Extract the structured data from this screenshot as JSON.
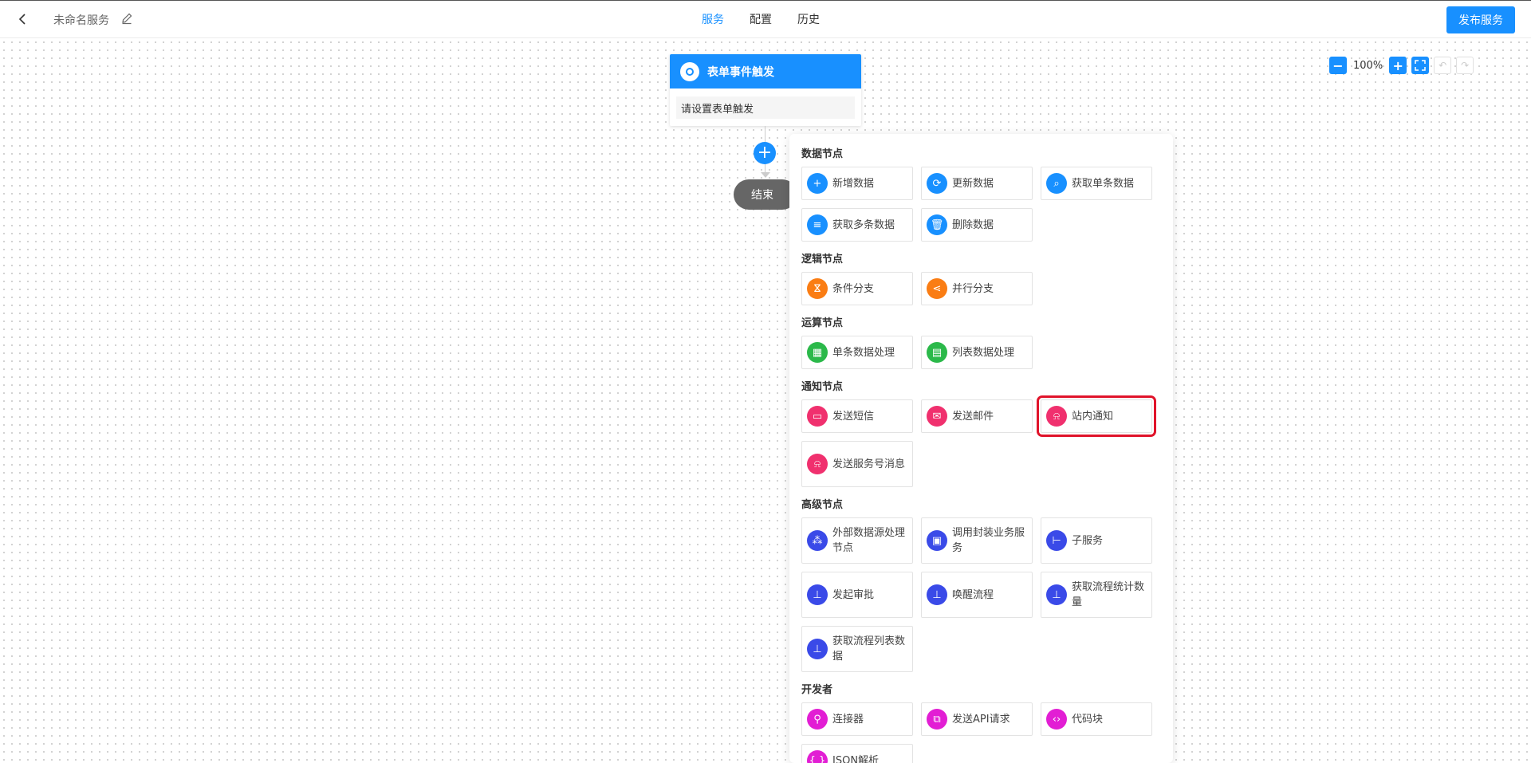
{
  "header": {
    "service_name": "未命名服务",
    "tabs": [
      {
        "label": "服务",
        "active": true
      },
      {
        "label": "配置",
        "active": false
      },
      {
        "label": "历史",
        "active": false
      }
    ],
    "publish_label": "发布服务"
  },
  "zoom": {
    "level": "100%"
  },
  "flow": {
    "trigger_title": "表单事件触发",
    "trigger_setting": "请设置表单触发",
    "end_label": "结束"
  },
  "panel": {
    "sections": [
      {
        "title": "数据节点",
        "items": [
          {
            "label": "新增数据",
            "icon": "plus-icon",
            "color": "blue"
          },
          {
            "label": "更新数据",
            "icon": "refresh-icon",
            "color": "blue"
          },
          {
            "label": "获取单条数据",
            "icon": "search-icon",
            "color": "blue"
          },
          {
            "label": "获取多条数据",
            "icon": "list-search-icon",
            "color": "blue"
          },
          {
            "label": "删除数据",
            "icon": "trash-icon",
            "color": "blue"
          }
        ]
      },
      {
        "title": "逻辑节点",
        "items": [
          {
            "label": "条件分支",
            "icon": "branch-icon",
            "color": "orange"
          },
          {
            "label": "并行分支",
            "icon": "share-icon",
            "color": "orange"
          }
        ]
      },
      {
        "title": "运算节点",
        "items": [
          {
            "label": "单条数据处理",
            "icon": "calculator-icon",
            "color": "green"
          },
          {
            "label": "列表数据处理",
            "icon": "list-icon",
            "color": "green"
          }
        ]
      },
      {
        "title": "通知节点",
        "items": [
          {
            "label": "发送短信",
            "icon": "message-icon",
            "color": "pink"
          },
          {
            "label": "发送邮件",
            "icon": "mail-icon",
            "color": "pink"
          },
          {
            "label": "站内通知",
            "icon": "bell-icon",
            "color": "pink",
            "highlight": true
          },
          {
            "label": "发送服务号消息",
            "icon": "bell-icon",
            "color": "pink",
            "tall": true
          }
        ]
      },
      {
        "title": "高级节点",
        "items": [
          {
            "label": "外部数据源处理节点",
            "icon": "datasource-icon",
            "color": "indigo",
            "tall": true
          },
          {
            "label": "调用封装业务服务",
            "icon": "package-icon",
            "color": "indigo",
            "tall": true
          },
          {
            "label": "子服务",
            "icon": "subservice-icon",
            "color": "indigo",
            "tall": true
          },
          {
            "label": "发起审批",
            "icon": "stamp-icon",
            "color": "indigo",
            "tall": true
          },
          {
            "label": "唤醒流程",
            "icon": "stamp-icon",
            "color": "indigo",
            "tall": true
          },
          {
            "label": "获取流程统计数量",
            "icon": "stamp-icon",
            "color": "indigo",
            "tall": true
          },
          {
            "label": "获取流程列表数据",
            "icon": "stamp-icon",
            "color": "indigo",
            "tall": true
          }
        ]
      },
      {
        "title": "开发者",
        "items": [
          {
            "label": "连接器",
            "icon": "link-icon",
            "color": "magenta"
          },
          {
            "label": "发送API请求",
            "icon": "api-icon",
            "color": "magenta"
          },
          {
            "label": "代码块",
            "icon": "code-icon",
            "color": "magenta"
          },
          {
            "label": "JSON解析",
            "icon": "json-icon",
            "color": "magenta"
          }
        ]
      }
    ]
  }
}
